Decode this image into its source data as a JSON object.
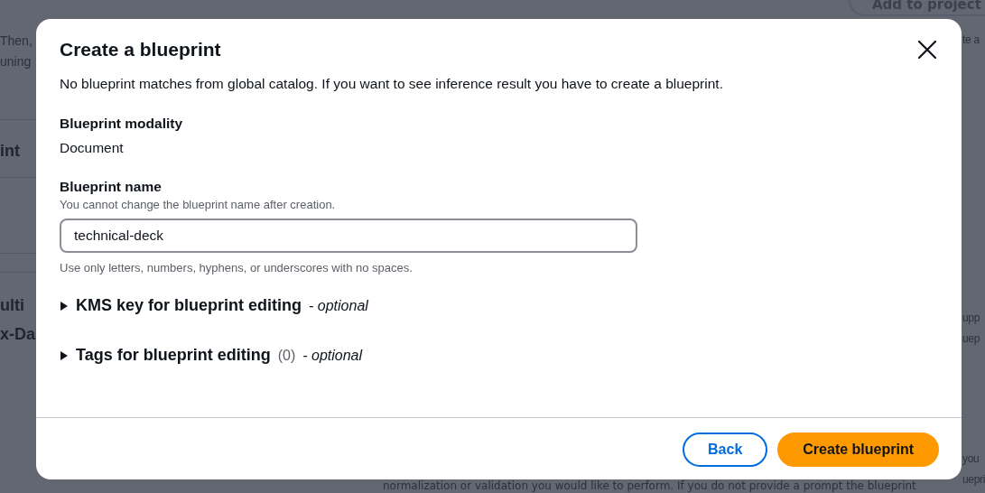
{
  "background": {
    "top_button": "Add to project",
    "left_fragments": [
      {
        "kind": "text",
        "text": "Then,"
      },
      {
        "kind": "text",
        "text": "uning"
      },
      {
        "kind": "heading",
        "text": "int"
      },
      {
        "kind": "heading",
        "text": "ulti"
      },
      {
        "kind": "heading",
        "text": "x-Da"
      }
    ],
    "right_fragments": [
      "te a",
      "upp",
      "uep",
      "you",
      "uepri"
    ],
    "bottom_text": "normalization or validation you would like to perform. If you do not provide a prompt the blueprint"
  },
  "dialog": {
    "title": "Create a blueprint",
    "description": "No blueprint matches from global catalog. If you want to see inference result you have to create a blueprint.",
    "modality": {
      "label": "Blueprint modality",
      "value": "Document"
    },
    "name_field": {
      "label": "Blueprint name",
      "description": "You cannot change the blueprint name after creation.",
      "value": "technical-deck",
      "constraint": "Use only letters, numbers, hyphens, or underscores with no spaces."
    },
    "sections": [
      {
        "label": "KMS key for blueprint editing",
        "optional": "- optional",
        "expanded": false
      },
      {
        "label": "Tags for blueprint editing",
        "count": "(0)",
        "optional": "- optional",
        "expanded": false
      }
    ],
    "buttons": [
      {
        "label": "Back",
        "kind": "secondary"
      },
      {
        "label": "Create blueprint",
        "kind": "primary"
      }
    ]
  }
}
